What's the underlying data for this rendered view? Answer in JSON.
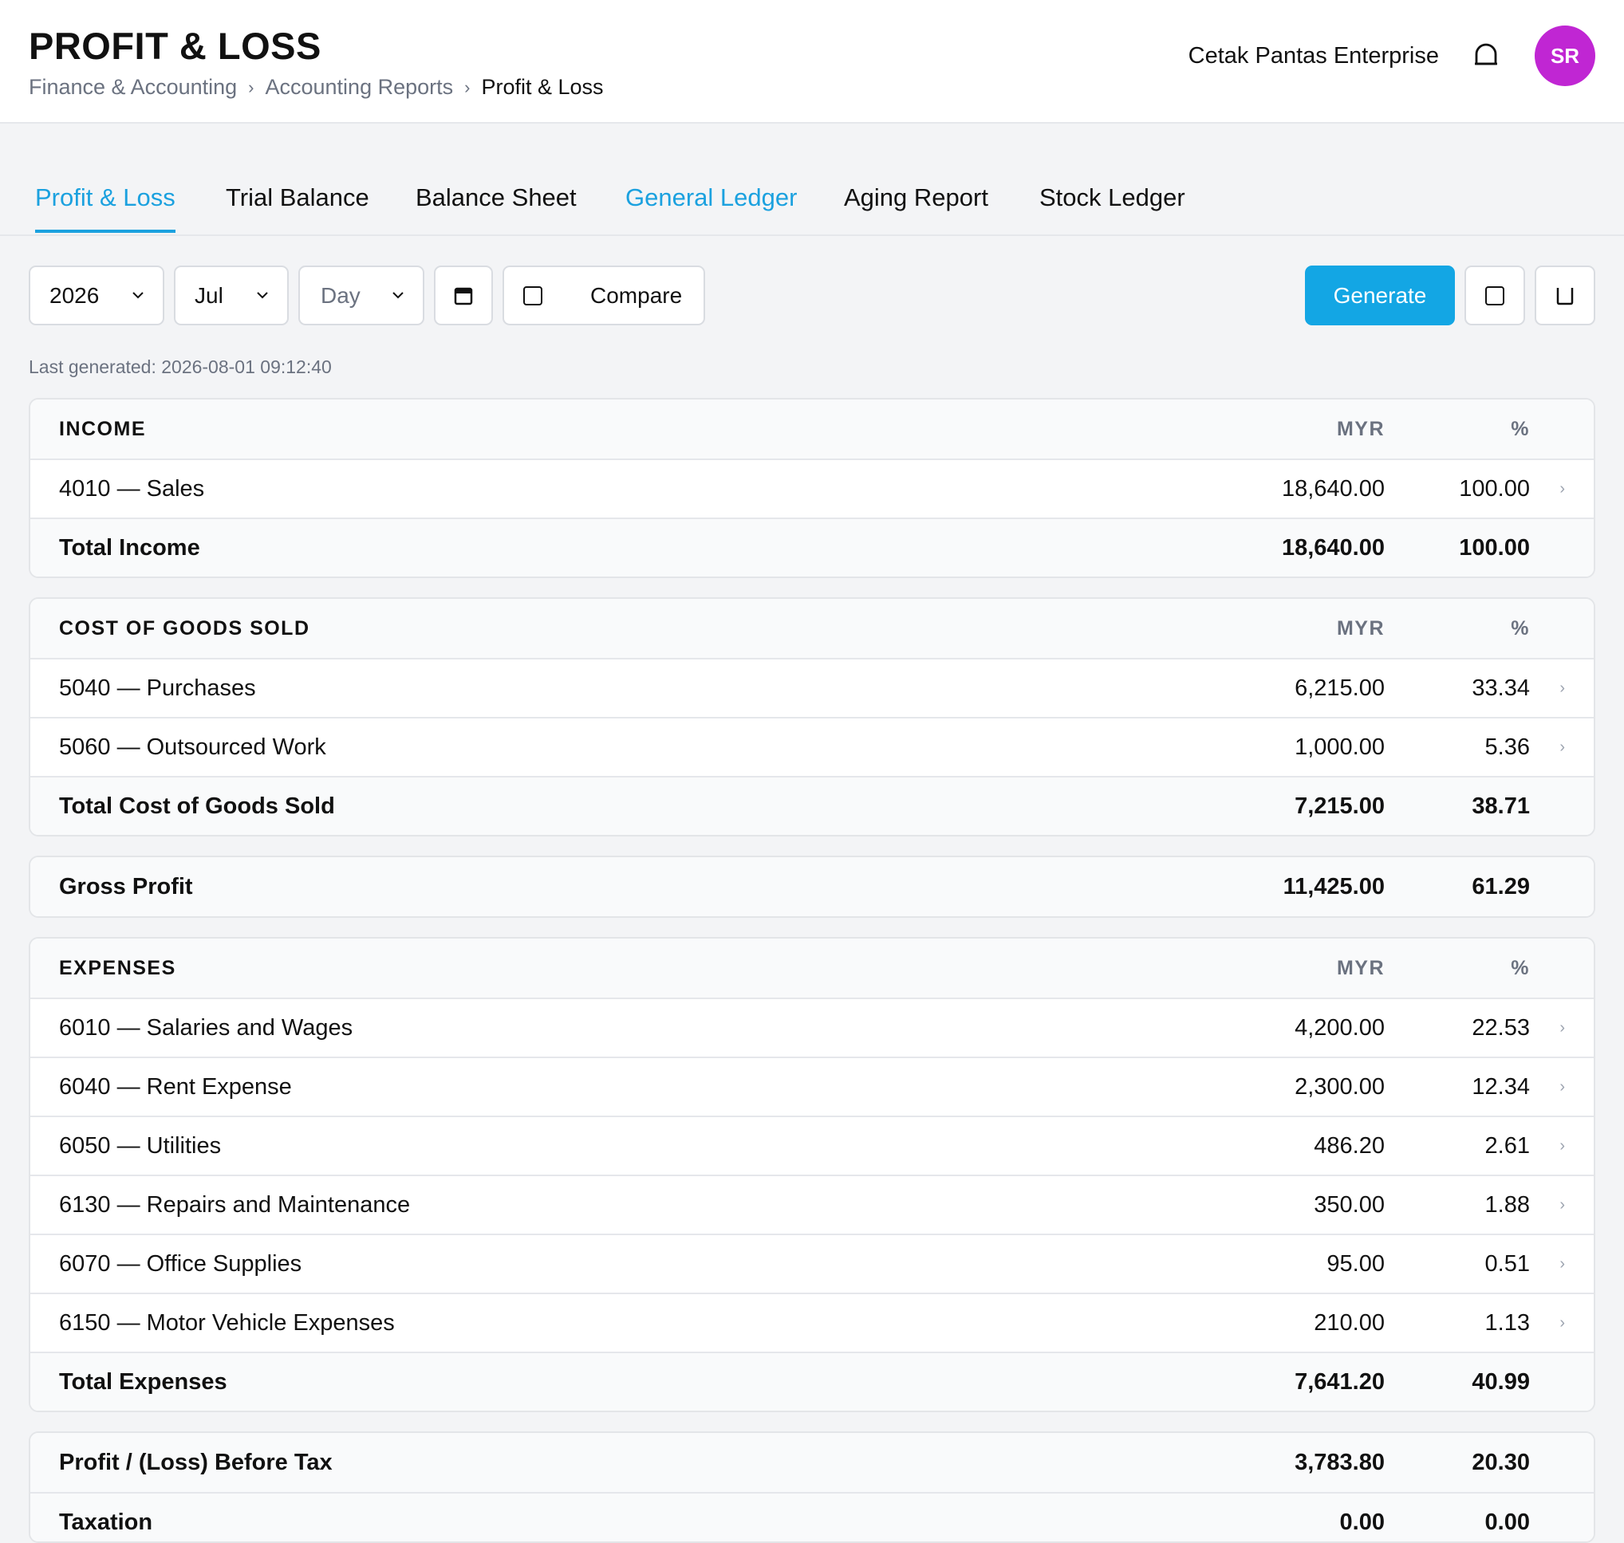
{
  "header": {
    "title": "PROFIT & LOSS",
    "breadcrumb": [
      "Finance & Accounting",
      "Accounting Reports",
      "Profit & Loss"
    ],
    "company": "Cetak Pantas Enterprise",
    "avatar_initials": "SR",
    "avatar_color": "#c026d3"
  },
  "tabs": [
    {
      "label": "Profit & Loss",
      "state": "active"
    },
    {
      "label": "Trial Balance"
    },
    {
      "label": "Balance Sheet"
    },
    {
      "label": "General Ledger",
      "state": "highlighted"
    },
    {
      "label": "Aging Report"
    },
    {
      "label": "Stock Ledger"
    }
  ],
  "toolbar": {
    "year": "2026",
    "month": "Jul",
    "day_placeholder": "Day",
    "compare_label": "Compare",
    "generate_label": "Generate",
    "accent_color": "#13a6e4"
  },
  "last_generated": "Last generated: 2026-08-01 09:12:40",
  "income": {
    "heading": "INCOME",
    "currency": "MYR",
    "pct": "%",
    "rows": [
      {
        "label": "4010 — Sales",
        "amount": "18,640.00",
        "pct": "100.00"
      }
    ],
    "total": {
      "label": "Total Income",
      "amount": "18,640.00",
      "pct": "100.00"
    }
  },
  "cogs": {
    "heading": "COST OF GOODS SOLD",
    "currency": "MYR",
    "pct": "%",
    "rows": [
      {
        "label": "5040 — Purchases",
        "amount": "6,215.00",
        "pct": "33.34"
      },
      {
        "label": "5060 — Outsourced Work",
        "amount": "1,000.00",
        "pct": "5.36"
      }
    ],
    "total": {
      "label": "Total Cost of Goods Sold",
      "amount": "7,215.00",
      "pct": "38.71"
    }
  },
  "gross_profit": {
    "label": "Gross Profit",
    "amount": "11,425.00",
    "pct": "61.29"
  },
  "expenses": {
    "heading": "EXPENSES",
    "currency": "MYR",
    "pct": "%",
    "rows": [
      {
        "label": "6010 — Salaries and Wages",
        "amount": "4,200.00",
        "pct": "22.53"
      },
      {
        "label": "6040 — Rent Expense",
        "amount": "2,300.00",
        "pct": "12.34"
      },
      {
        "label": "6050 — Utilities",
        "amount": "486.20",
        "pct": "2.61"
      },
      {
        "label": "6130 — Repairs and Maintenance",
        "amount": "350.00",
        "pct": "1.88"
      },
      {
        "label": "6070 — Office Supplies",
        "amount": "95.00",
        "pct": "0.51"
      },
      {
        "label": "6150 — Motor Vehicle Expenses",
        "amount": "210.00",
        "pct": "1.13"
      }
    ],
    "total": {
      "label": "Total Expenses",
      "amount": "7,641.20",
      "pct": "40.99"
    }
  },
  "before_tax": {
    "label": "Profit / (Loss) Before Tax",
    "amount": "3,783.80",
    "pct": "20.30"
  },
  "taxation": {
    "label": "Taxation",
    "amount": "0.00",
    "pct": "0.00"
  },
  "row_arrow": "›"
}
